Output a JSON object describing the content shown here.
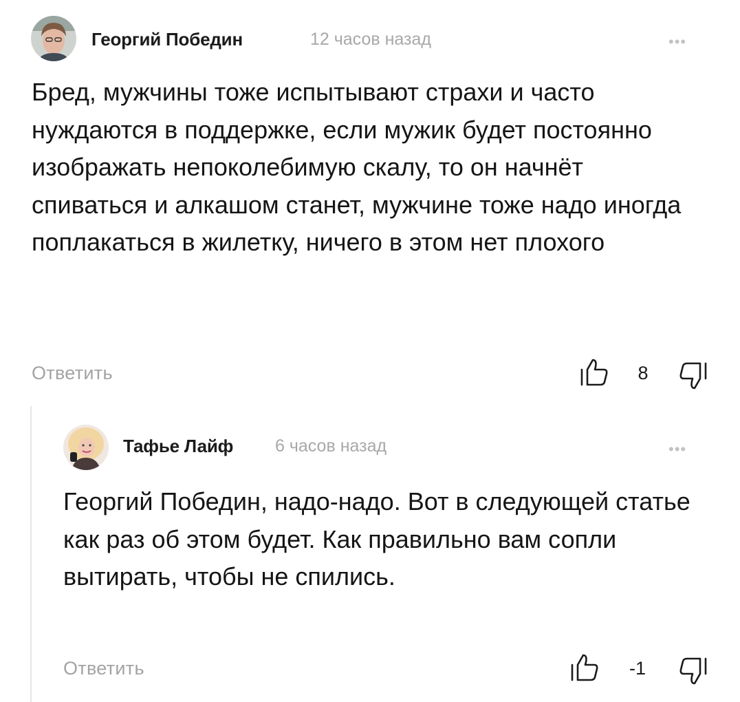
{
  "comments": [
    {
      "author": "Георгий Победин",
      "time": "12 часов назад",
      "more": "•••",
      "text": "Бред, мужчины тоже испытывают страхи и часто нуждаются в поддержке, если мужик будет постоянно изображать непоколебимую скалу, то он начнёт спиваться и алкашом станет, мужчине тоже надо иногда поплакаться в жилетку, ничего в этом нет плохого",
      "reply_label": "Ответить",
      "rating": "8",
      "icons": {
        "avatar": "user-photo-avatar",
        "like": "thumbs-up-icon",
        "dislike": "thumbs-down-icon"
      }
    },
    {
      "author": "Тафье Лайф",
      "time": "6 часов назад",
      "more": "•••",
      "text": "Георгий Победин, надо-надо. Вот в следующей статье как раз об этом будет. Как правильно вам сопли вытирать, чтобы не спились.",
      "reply_label": "Ответить",
      "rating": "-1",
      "icons": {
        "avatar": "user-photo-avatar",
        "like": "thumbs-up-icon",
        "dislike": "thumbs-down-icon"
      }
    }
  ],
  "colors": {
    "text": "#151515",
    "muted": "#a3a3a3",
    "thread_line": "#e6e6e6"
  }
}
